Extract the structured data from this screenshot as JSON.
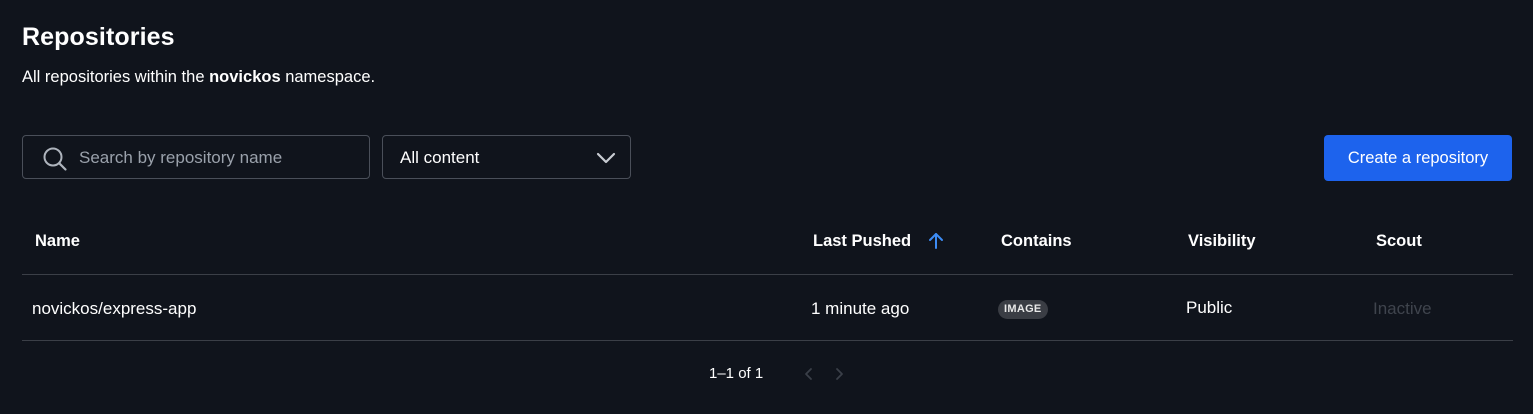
{
  "header": {
    "title": "Repositories",
    "subtitle_prefix": "All repositories within the ",
    "namespace": "novickos",
    "subtitle_suffix": " namespace."
  },
  "toolbar": {
    "search_placeholder": "Search by repository name",
    "search_value": "",
    "filter_selected": "All content",
    "create_label": "Create a repository"
  },
  "table": {
    "columns": [
      "Name",
      "Last Pushed",
      "Contains",
      "Visibility",
      "Scout"
    ],
    "sort_column": "Last Pushed",
    "sort_direction": "ascending",
    "rows": [
      {
        "name": "novickos/express-app",
        "last_pushed": "1 minute ago",
        "contains": "IMAGE",
        "visibility": "Public",
        "scout": "Inactive"
      }
    ]
  },
  "pagination": {
    "label": "1–1 of 1"
  },
  "icons": {
    "search": "search-icon",
    "dropdown": "chevron-down-icon",
    "sort": "arrow-up-icon",
    "prev": "chevron-left-icon",
    "next": "chevron-right-icon"
  },
  "colors": {
    "background": "#10141c",
    "accent": "#1d63ed",
    "sort_arrow": "#3d8cf5",
    "border": "#4a4f59"
  }
}
